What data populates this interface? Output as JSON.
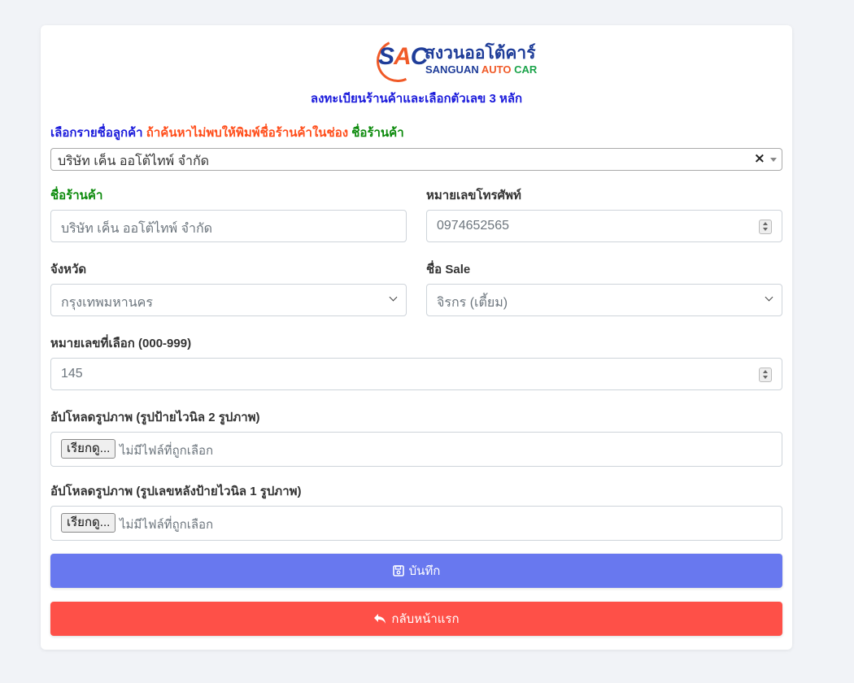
{
  "logo": {
    "sac": "SAC",
    "thai": "สงวนออโต้คาร์",
    "eng1": "SANGUAN",
    "eng2": "AUTO",
    "eng3": "CAR"
  },
  "title": "ลงทะเบียนร้านค้าและเลือกตัวเลข 3 หลัก",
  "instruction": {
    "part1": "เลือกรายชื่อลูกค้า",
    "part2": "ถ้าค้นหาไม่พบให้พิมพ์ชื่อร้านค้าในช่อง",
    "part3": "ชื่อร้านค้า"
  },
  "customer_select": {
    "value": "บริษัท เค็น ออโต้ไทพ์ จำกัด"
  },
  "shop_name": {
    "label": "ชื่อร้านค้า",
    "value": "บริษัท เค็น ออโต้ไทพ์ จำกัด"
  },
  "phone": {
    "label": "หมายเลขโทรศัพท์",
    "value": "0974652565"
  },
  "province": {
    "label": "จังหวัด",
    "value": "กรุงเทพมหานคร"
  },
  "sale": {
    "label": "ชื่อ Sale",
    "value": "จิรกร (เตี้ยม)"
  },
  "number": {
    "label": "หมายเลขที่เลือก (000-999)",
    "value": "145"
  },
  "upload1": {
    "label": "อัปโหลดรูปภาพ (รูปป้ายไวนิล 2 รูปภาพ)",
    "button": "เรียกดู...",
    "status": "ไม่มีไฟล์ที่ถูกเลือก"
  },
  "upload2": {
    "label": "อัปโหลดรูปภาพ (รูปเลขหลังป้ายไวนิล 1 รูปภาพ)",
    "button": "เรียกดู...",
    "status": "ไม่มีไฟล์ที่ถูกเลือก"
  },
  "buttons": {
    "save": "บันทึก",
    "back": "กลับหน้าแรก"
  },
  "icons": {
    "save": "floppy-disk-icon",
    "back": "reply-arrow-icon"
  },
  "colors": {
    "save": "#6878ef",
    "back": "#fe5048",
    "title": "#1a1adb",
    "green": "#0b8a0b",
    "orange": "#ff4d1a"
  }
}
